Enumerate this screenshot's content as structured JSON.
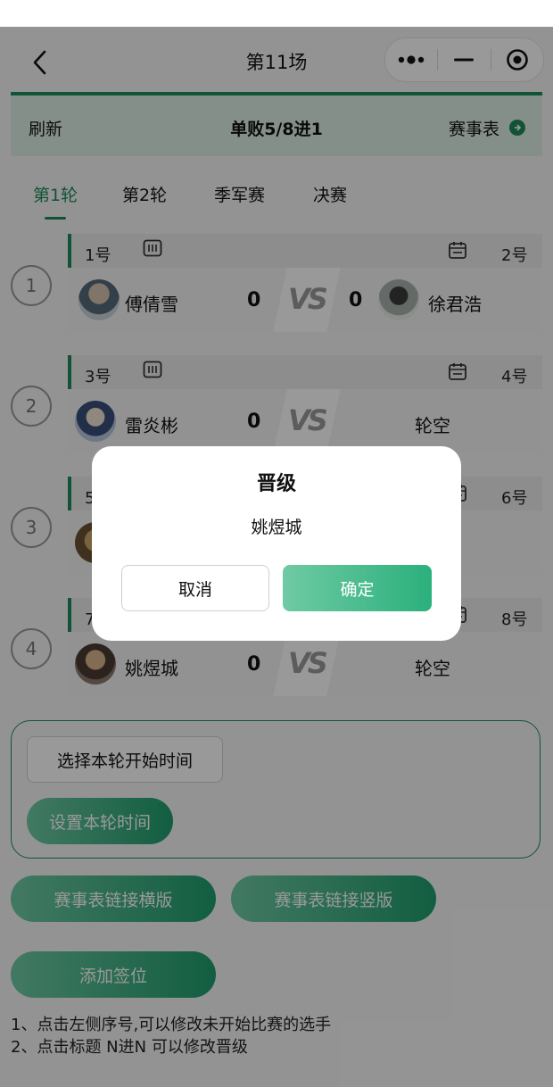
{
  "nav": {
    "title": "第11场"
  },
  "header": {
    "refresh": "刷新",
    "format": "单败5/8进1",
    "bracket": "赛事表"
  },
  "tabs": [
    "第1轮",
    "第2轮",
    "季军赛",
    "决赛"
  ],
  "matches": [
    {
      "num": "1",
      "left_seed": "1号",
      "right_seed": "2号",
      "left_player": "傅倩雪",
      "right_player": "徐君浩",
      "left_score": "0",
      "right_score": "0",
      "vs": "VS"
    },
    {
      "num": "2",
      "left_seed": "3号",
      "right_seed": "4号",
      "left_player": "雷炎彬",
      "right_player": "轮空",
      "left_score": "0",
      "right_score": "",
      "vs": "VS"
    },
    {
      "num": "3",
      "left_seed": "5号",
      "right_seed": "6号",
      "left_player": "",
      "right_player": "",
      "left_score": "",
      "right_score": "",
      "vs": ""
    },
    {
      "num": "4",
      "left_seed": "7号",
      "right_seed": "8号",
      "left_player": "姚煜城",
      "right_player": "轮空",
      "left_score": "0",
      "right_score": "",
      "vs": "VS"
    }
  ],
  "time": {
    "select": "选择本轮开始时间",
    "set": "设置本轮时间"
  },
  "links": {
    "horizontal": "赛事表链接横版",
    "vertical": "赛事表链接竖版",
    "add_slot": "添加签位"
  },
  "notes": [
    "1、点击左侧序号,可以修改未开始比赛的选手",
    "2、点击标题 N进N 可以修改晋级"
  ],
  "dialog": {
    "title": "晋级",
    "message": "姚煜城",
    "cancel": "取消",
    "confirm": "确定"
  },
  "colors": {
    "accent": "#1f8a5b",
    "band": "#dcefe6",
    "button_gradient": [
      "#6fcaa4",
      "#1f9d6e"
    ]
  },
  "icons": {
    "back": "chevron-left-icon",
    "more": "more-dots-icon",
    "minimize": "minimize-icon",
    "close": "target-circle-icon",
    "arrow": "arrow-right-circle-icon",
    "keyboard": "keyboard-icon",
    "calendar": "calendar-icon"
  }
}
